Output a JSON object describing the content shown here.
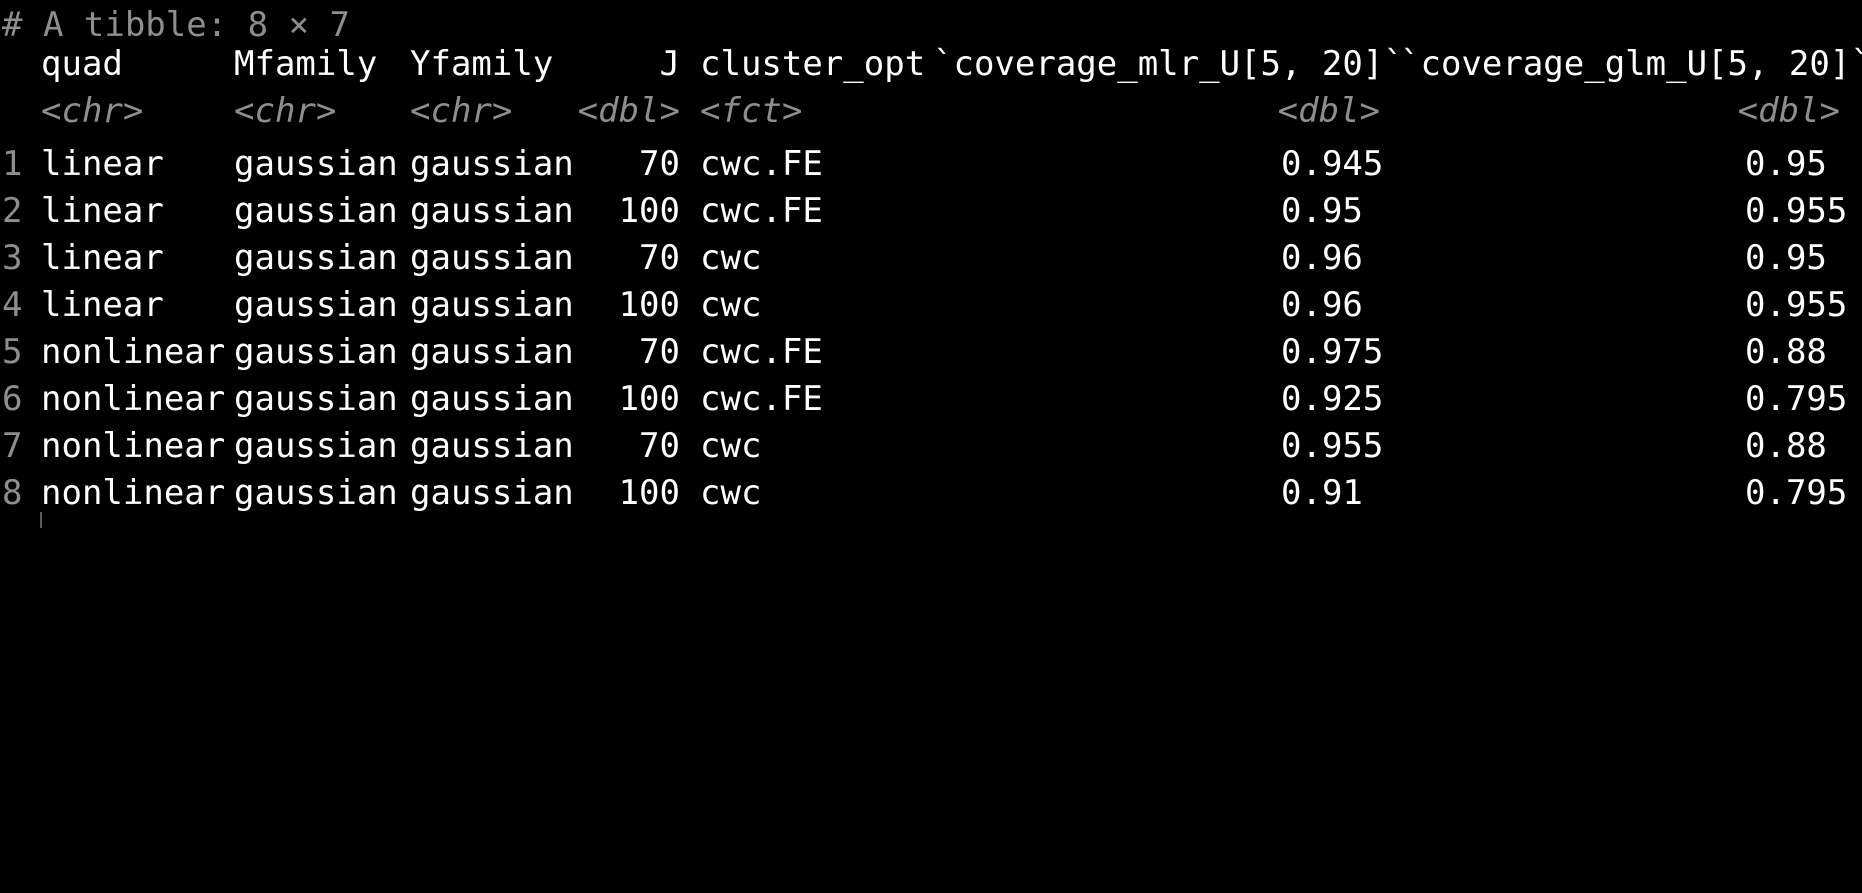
{
  "tibble_header": "# A tibble: 8 × 7",
  "columns": [
    {
      "name": "quad",
      "type": "<chr>"
    },
    {
      "name": "Mfamily",
      "type": "<chr>"
    },
    {
      "name": "Yfamily",
      "type": "<chr>"
    },
    {
      "name": "J",
      "type": "<dbl>"
    },
    {
      "name": "cluster_opt",
      "type": "<fct>"
    },
    {
      "name": "`coverage_mlr_U[5, 20]`",
      "type": "<dbl>"
    },
    {
      "name": "`coverage_glm_U[5, 20]`",
      "type": "<dbl>"
    }
  ],
  "rows": [
    {
      "index": "1",
      "quad": "linear",
      "Mfamily": "gaussian",
      "Yfamily": "gaussian",
      "J": "70",
      "cluster_opt": "cwc.FE",
      "mlr": "0.945",
      "glm": "0.95"
    },
    {
      "index": "2",
      "quad": "linear",
      "Mfamily": "gaussian",
      "Yfamily": "gaussian",
      "J": "100",
      "cluster_opt": "cwc.FE",
      "mlr": "0.95",
      "glm": "0.955"
    },
    {
      "index": "3",
      "quad": "linear",
      "Mfamily": "gaussian",
      "Yfamily": "gaussian",
      "J": "70",
      "cluster_opt": "cwc",
      "mlr": "0.96",
      "glm": "0.95"
    },
    {
      "index": "4",
      "quad": "linear",
      "Mfamily": "gaussian",
      "Yfamily": "gaussian",
      "J": "100",
      "cluster_opt": "cwc",
      "mlr": "0.96",
      "glm": "0.955"
    },
    {
      "index": "5",
      "quad": "nonlinear",
      "Mfamily": "gaussian",
      "Yfamily": "gaussian",
      "J": "70",
      "cluster_opt": "cwc.FE",
      "mlr": "0.975",
      "glm": "0.88"
    },
    {
      "index": "6",
      "quad": "nonlinear",
      "Mfamily": "gaussian",
      "Yfamily": "gaussian",
      "J": "100",
      "cluster_opt": "cwc.FE",
      "mlr": "0.925",
      "glm": "0.795"
    },
    {
      "index": "7",
      "quad": "nonlinear",
      "Mfamily": "gaussian",
      "Yfamily": "gaussian",
      "J": "70",
      "cluster_opt": "cwc",
      "mlr": "0.955",
      "glm": "0.88"
    },
    {
      "index": "8",
      "quad": "nonlinear",
      "Mfamily": "gaussian",
      "Yfamily": "gaussian",
      "J": "100",
      "cluster_opt": "cwc",
      "mlr": "0.91",
      "glm": "0.795"
    }
  ]
}
